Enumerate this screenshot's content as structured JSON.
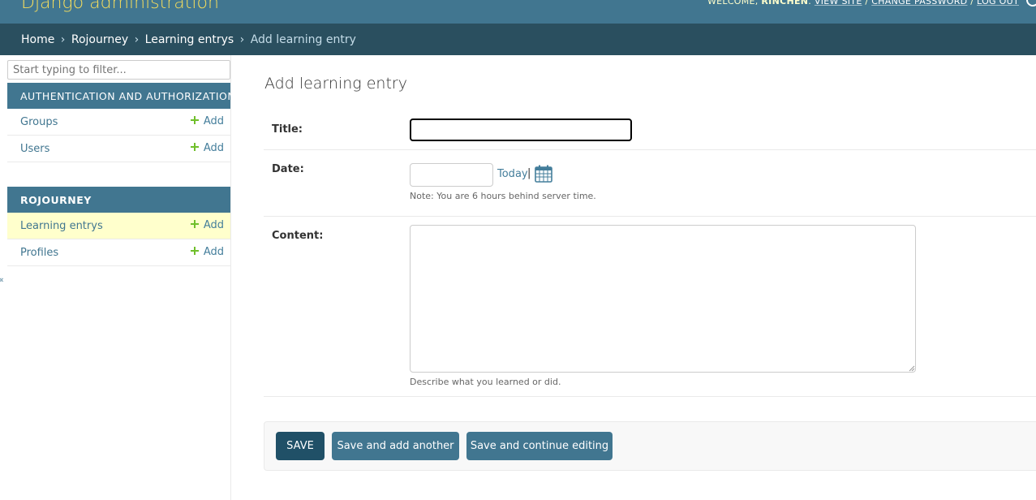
{
  "header": {
    "branding": "Django administration",
    "welcome": "Welcome,",
    "username": "Rinchen",
    "view_site": "View site",
    "change_password": "Change password",
    "log_out": "Log out",
    "sep": "/",
    "colors": {
      "header_bg": "#417690",
      "branding": "#f5dd5d",
      "breadcrumbs_bg": "#2a4f5f"
    }
  },
  "breadcrumbs": {
    "home": "Home",
    "app": "Rojourney",
    "model": "Learning entrys",
    "current": "Add learning entry",
    "separator": "›"
  },
  "sidebar": {
    "filter_placeholder": "Start typing to filter...",
    "toggle": "«",
    "apps": [
      {
        "caption": "Authentication and Authorization",
        "models": [
          {
            "name": "Groups",
            "add": "Add"
          },
          {
            "name": "Users",
            "add": "Add"
          }
        ]
      },
      {
        "caption": "Rojourney",
        "models": [
          {
            "name": "Learning entrys",
            "add": "Add",
            "current": true
          },
          {
            "name": "Profiles",
            "add": "Add"
          }
        ]
      }
    ]
  },
  "main": {
    "title": "Add learning entry",
    "fields": {
      "title": {
        "label": "Title:",
        "value": ""
      },
      "date": {
        "label": "Date:",
        "value": "",
        "today": "Today",
        "sep": "|",
        "note": "Note: You are 6 hours behind server time."
      },
      "content": {
        "label": "Content:",
        "value": "",
        "help": "Describe what you learned or did."
      }
    },
    "buttons": {
      "save": "Save",
      "save_add": "Save and add another",
      "save_continue": "Save and continue editing"
    }
  }
}
